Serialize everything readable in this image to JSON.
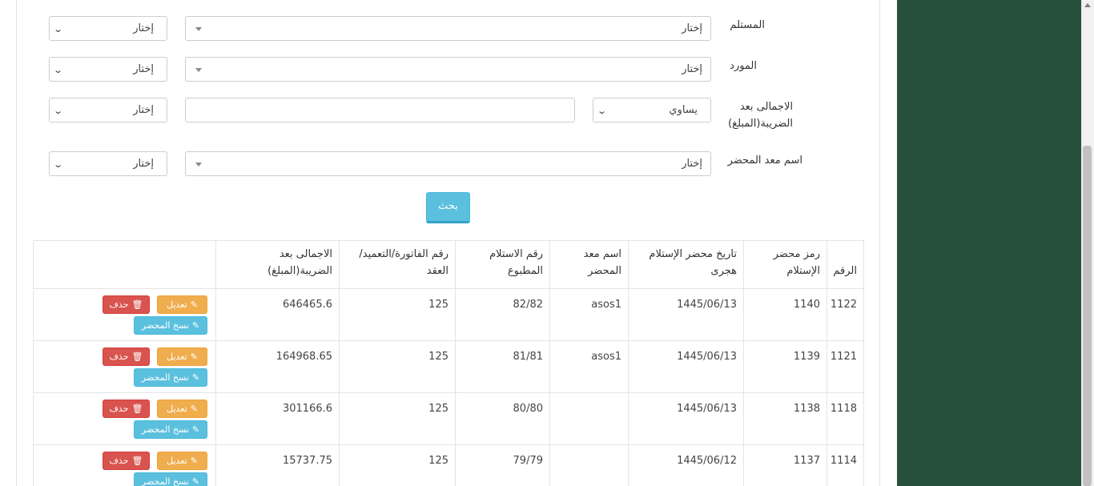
{
  "filters": {
    "receiver": {
      "label": "المستلم",
      "select_value": "إختار",
      "side_value": "إختار"
    },
    "supplier": {
      "label": "المورد",
      "select_value": "إختار",
      "side_value": "إختار"
    },
    "total": {
      "label_line1": "الاجمالى بعد",
      "label_line2": "الضريبة(المبلغ)",
      "operator_value": "يساوي",
      "input_value": "",
      "side_value": "إختار"
    },
    "prep": {
      "label": "اسم معد المحضر",
      "select_value": "إختار",
      "side_value": "إختار"
    }
  },
  "search_label": "بحث",
  "table": {
    "headers": {
      "num": "الرقم",
      "code_l1": "رمز محضر",
      "code_l2": "الإستلام",
      "date_l1": "تاريخ محضر الإستلام",
      "date_l2": "هجرى",
      "prep_l1": "اسم معد",
      "prep_l2": "المحضر",
      "recv_l1": "رقم الاستلام",
      "recv_l2": "المطبوع",
      "inv_l1": "رقم الفاتورة/التعميد/",
      "inv_l2": "العقد",
      "total_l1": "الاجمالى بعد",
      "total_l2": "الضريبة(المبلغ)",
      "actions": ""
    },
    "rows": [
      {
        "num": "1122",
        "code": "1140",
        "date": "1445/06/13",
        "prep": "asos1",
        "recv": "82/82",
        "inv": "125",
        "total": "646465.6"
      },
      {
        "num": "1121",
        "code": "1139",
        "date": "1445/06/13",
        "prep": "asos1",
        "recv": "81/81",
        "inv": "125",
        "total": "164968.65"
      },
      {
        "num": "1118",
        "code": "1138",
        "date": "1445/06/13",
        "prep": "",
        "recv": "80/80",
        "inv": "125",
        "total": "301166.6"
      },
      {
        "num": "1114",
        "code": "1137",
        "date": "1445/06/12",
        "prep": "",
        "recv": "79/79",
        "inv": "125",
        "total": "15737.75"
      }
    ],
    "actions": {
      "edit": "تعديل",
      "delete": "حذف",
      "copy": "نسخ المحضر"
    }
  },
  "colors": {
    "sidebar": "#26503a",
    "search": "#5bc0de",
    "edit": "#f0ad4e",
    "delete": "#d9534f",
    "copy": "#5bc0de"
  },
  "icons": {
    "edit": "pencil-icon",
    "delete": "trash-icon",
    "copy": "pencil-icon",
    "select": "chevron-down-icon"
  }
}
